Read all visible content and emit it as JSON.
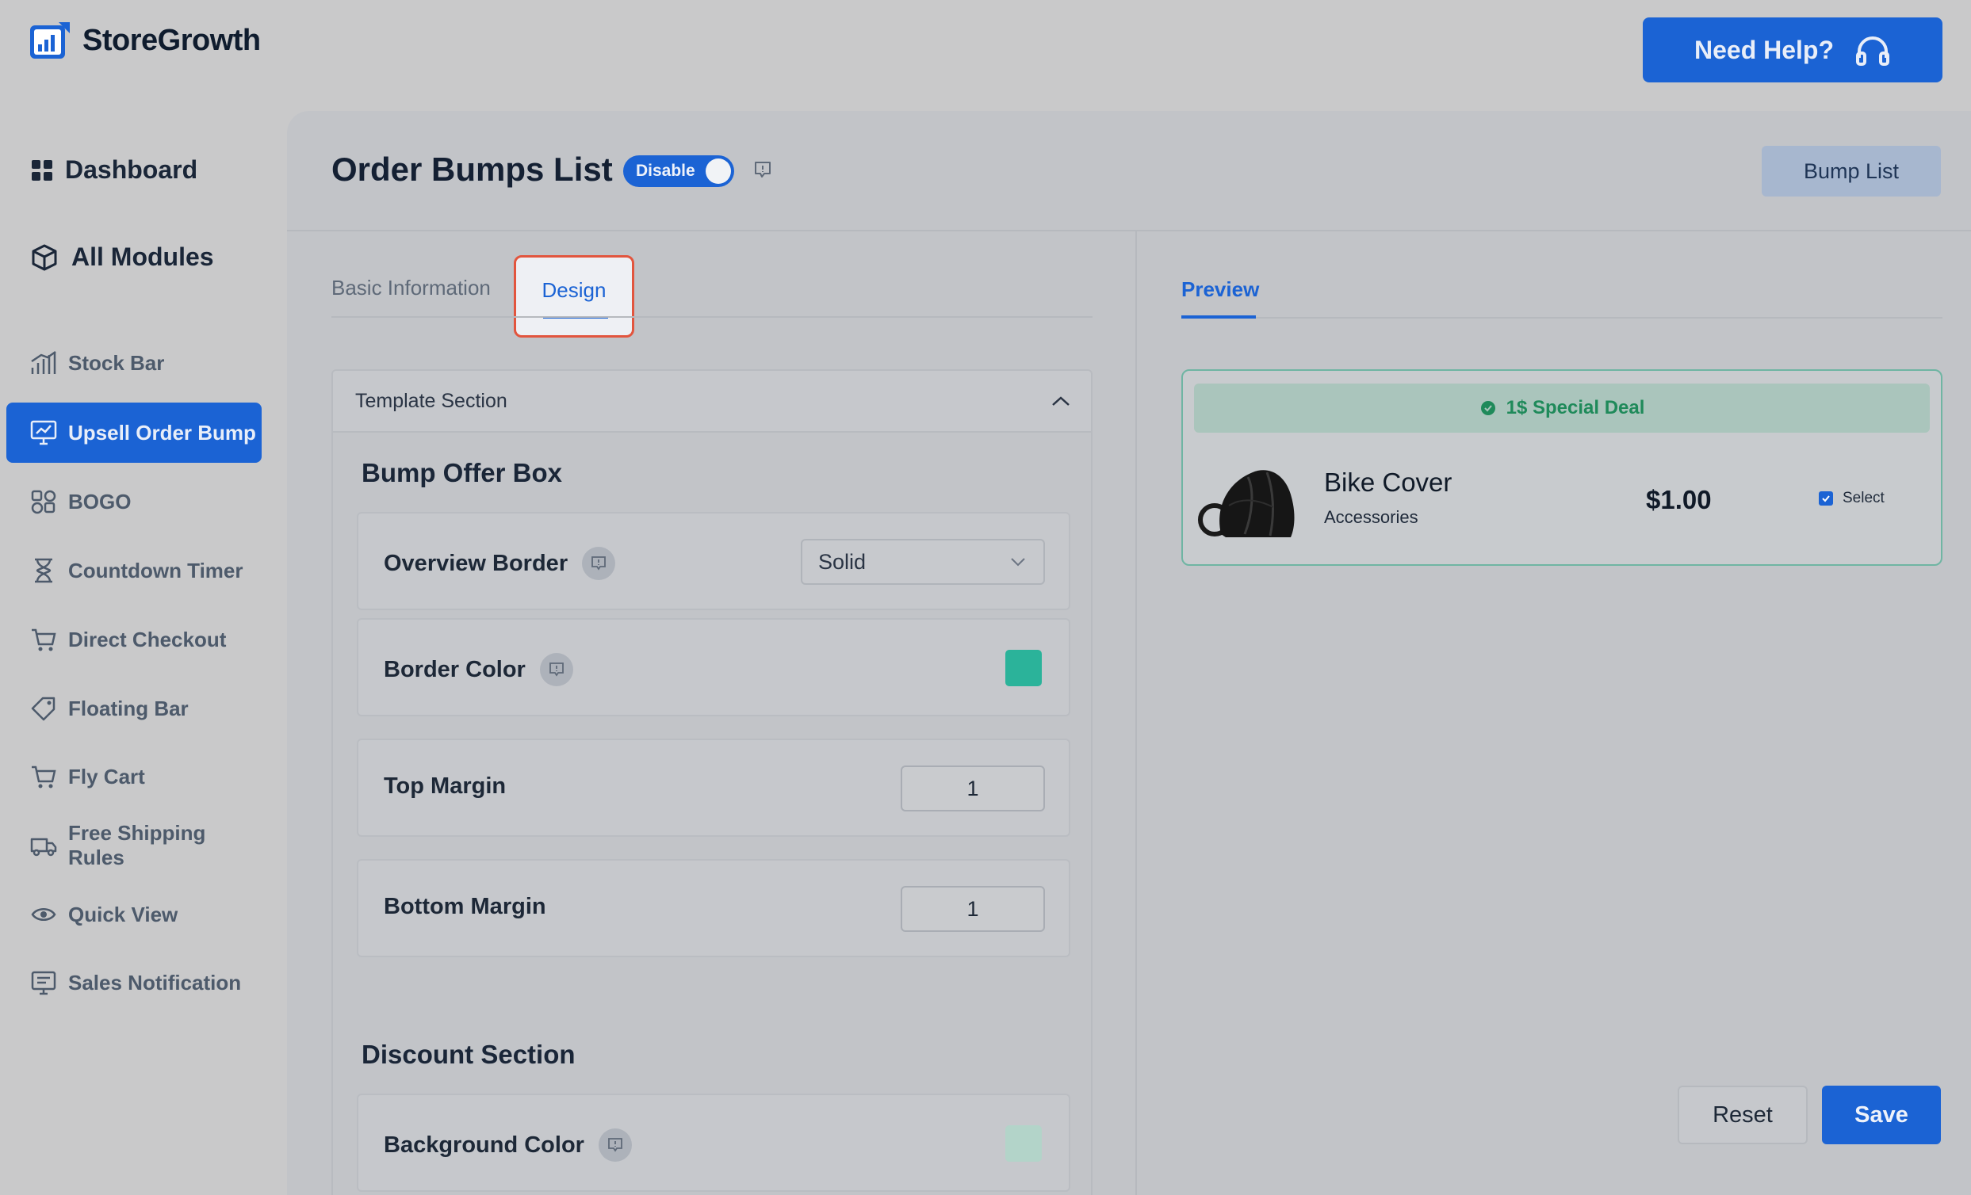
{
  "brand": {
    "name": "StoreGrowth"
  },
  "header": {
    "help_label": "Need Help?"
  },
  "sidebar": {
    "top_items": [
      {
        "label": "Dashboard",
        "icon": "grid-icon"
      },
      {
        "label": "All Modules",
        "icon": "cube-icon"
      }
    ],
    "items": [
      {
        "label": "Stock Bar",
        "icon": "bar-chart-icon"
      },
      {
        "label": "Upsell Order Bump",
        "icon": "monitor-chart-icon",
        "active": true
      },
      {
        "label": "BOGO",
        "icon": "bogo-icon"
      },
      {
        "label": "Countdown Timer",
        "icon": "hourglass-icon"
      },
      {
        "label": "Direct Checkout",
        "icon": "cart-icon"
      },
      {
        "label": "Floating Bar",
        "icon": "tag-icon"
      },
      {
        "label": "Fly Cart",
        "icon": "cart-icon"
      },
      {
        "label": "Free Shipping Rules",
        "icon": "truck-icon"
      },
      {
        "label": "Quick View",
        "icon": "eye-icon"
      },
      {
        "label": "Sales Notification",
        "icon": "notification-icon"
      }
    ]
  },
  "page": {
    "title": "Order Bumps List",
    "toggle_label": "Disable",
    "bump_list_label": "Bump List"
  },
  "tabs": {
    "basic": "Basic Information",
    "design": "Design",
    "preview": "Preview"
  },
  "template": {
    "section_label": "Template Section",
    "bump_offer_title": "Bump Offer Box",
    "rows": {
      "overview_border": {
        "label": "Overview Border",
        "value": "Solid"
      },
      "border_color": {
        "label": "Border Color",
        "color": "#2bb39a"
      },
      "top_margin": {
        "label": "Top Margin",
        "value": "1"
      },
      "bottom_margin": {
        "label": "Bottom Margin",
        "value": "1"
      }
    },
    "discount_title": "Discount Section",
    "background_color": {
      "label": "Background Color",
      "color": "#b3d4c9"
    }
  },
  "preview": {
    "deal_label": "1$ Special Deal",
    "product_name": "Bike Cover",
    "product_category": "Accessories",
    "price": "$1.00",
    "select_label": "Select"
  },
  "actions": {
    "reset": "Reset",
    "save": "Save"
  },
  "colors": {
    "accent": "#1b63d4",
    "highlight": "#e2553e",
    "deal_green": "#1f8a5a"
  }
}
